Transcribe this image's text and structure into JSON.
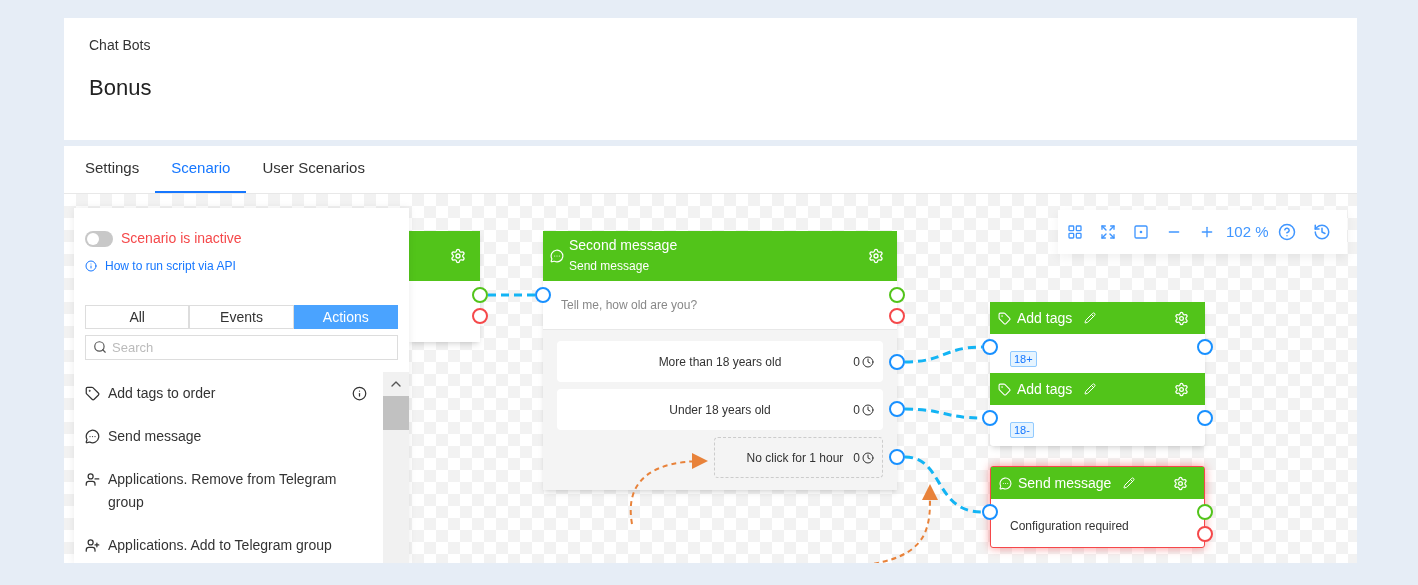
{
  "header": {
    "breadcrumb": "Chat Bots",
    "title": "Bonus"
  },
  "tabs": [
    {
      "label": "Settings",
      "selected": false
    },
    {
      "label": "Scenario",
      "selected": true
    },
    {
      "label": "User Scenarios",
      "selected": false
    }
  ],
  "panel": {
    "status": {
      "label": "Scenario is inactive",
      "on": false
    },
    "help_link": "How to run script via API",
    "filter_tabs": [
      {
        "label": "All",
        "selected": false
      },
      {
        "label": "Events",
        "selected": false
      },
      {
        "label": "Actions",
        "selected": true
      }
    ],
    "search": {
      "placeholder": "Search"
    },
    "items": [
      {
        "label": "Add tags to order",
        "kind": "tag",
        "info": true
      },
      {
        "label": "Send message",
        "kind": "message",
        "info": false
      },
      {
        "label": "Applications. Remove from Telegram group",
        "kind": "user-minus",
        "info": false
      },
      {
        "label": "Applications. Add to Telegram group",
        "kind": "user-plus",
        "info": false
      }
    ]
  },
  "question_node": {
    "title": "Second message",
    "subtitle": "Send message",
    "text": "Tell me, how old are you?",
    "answers": [
      {
        "label": "More than 18 years old",
        "count": "0",
        "kind": "button"
      },
      {
        "label": "Under 18 years old",
        "count": "0",
        "kind": "button"
      },
      {
        "label": "No click for 1 hour",
        "count": "0",
        "kind": "timeout"
      }
    ]
  },
  "action_nodes": [
    {
      "kind": "tags",
      "title": "Add tags",
      "tag": "18+",
      "error": false
    },
    {
      "kind": "tags",
      "title": "Add tags",
      "tag": "18-",
      "error": false
    },
    {
      "kind": "message",
      "title": "Send message",
      "text": "Configuration required",
      "error": true
    }
  ],
  "toolbar": {
    "zoom": "102 %"
  }
}
